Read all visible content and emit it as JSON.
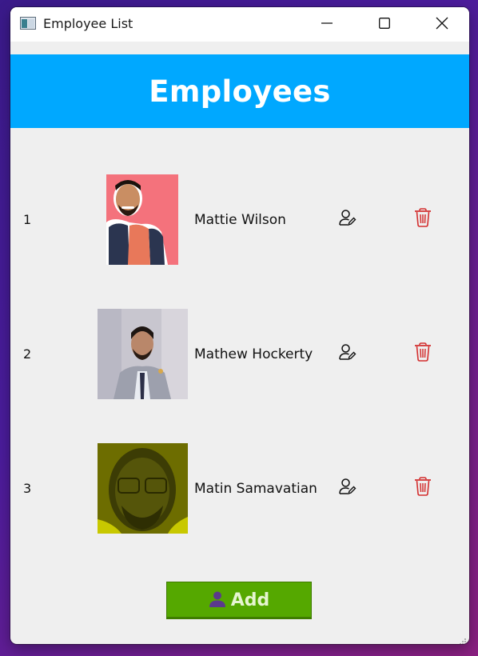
{
  "window": {
    "title": "Employee List"
  },
  "header": {
    "title": "Employees"
  },
  "employees": [
    {
      "index": "1",
      "name": "Mattie Wilson"
    },
    {
      "index": "2",
      "name": "Mathew Hockerty"
    },
    {
      "index": "3",
      "name": "Matin Samavatian"
    }
  ],
  "actions": {
    "add_label": "Add"
  },
  "icons": {
    "app": "app-window-icon",
    "minimize": "minimize-icon",
    "maximize": "maximize-icon",
    "close": "close-icon",
    "edit": "user-edit-icon",
    "delete": "trash-icon",
    "add": "user-icon"
  },
  "colors": {
    "header_bg": "#00a8ff",
    "add_button_bg": "#55a800",
    "delete_icon": "#d32f2f"
  }
}
